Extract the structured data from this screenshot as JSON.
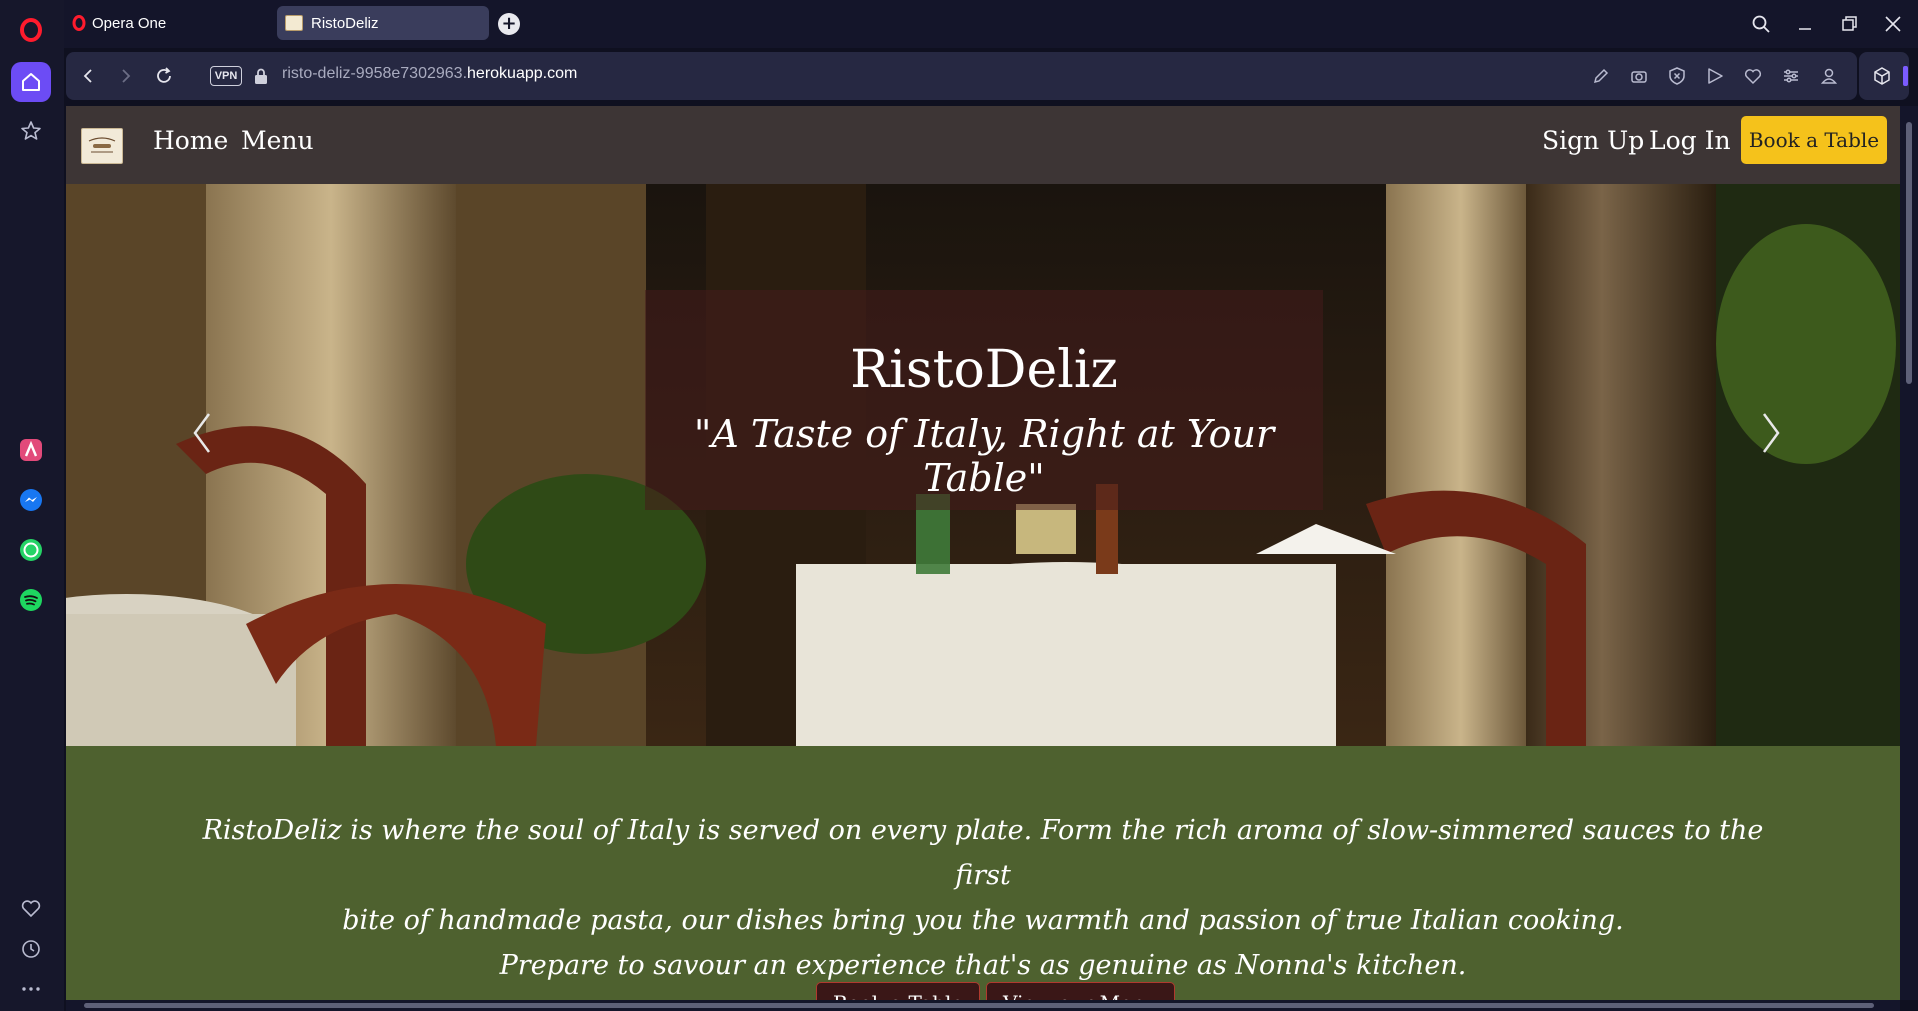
{
  "browser": {
    "brand_label": "Opera One",
    "tab_title": "RistoDeliz",
    "url_prefix": "risto-deliz-9958e7302963.",
    "url_domain": "herokuapp.com",
    "vpn_label": "VPN",
    "accent_color": "#7b5cff"
  },
  "sidebar": {
    "icons": [
      "opera-logo-icon",
      "home-icon",
      "star-icon",
      "aria-icon",
      "messenger-icon",
      "whatsapp-icon",
      "spotify-icon",
      "heart-icon",
      "history-icon",
      "more-icon"
    ]
  },
  "site": {
    "nav": {
      "home": "Home",
      "menu": "Menu",
      "signup": "Sign Up",
      "login": "Log In",
      "book": "Book a Table"
    },
    "hero": {
      "title": "RistoDeliz",
      "tagline": "\"A Taste of Italy, Right at Your Table\""
    },
    "intro": {
      "line1": "RistoDeliz is where the soul of Italy is served on every plate. Form the rich aroma of slow-simmered sauces to the first",
      "line2": "bite of handmade pasta, our dishes bring you the warmth and passion of true Italian cooking.",
      "line3": "Prepare to savour an experience that's as genuine as Nonna's kitchen.",
      "button_book": "Book a Table",
      "button_menu": "View our Menu"
    },
    "colors": {
      "nav_bg": "#3d3535",
      "cta": "#f5c21b",
      "intro_bg": "#4e612f"
    }
  }
}
